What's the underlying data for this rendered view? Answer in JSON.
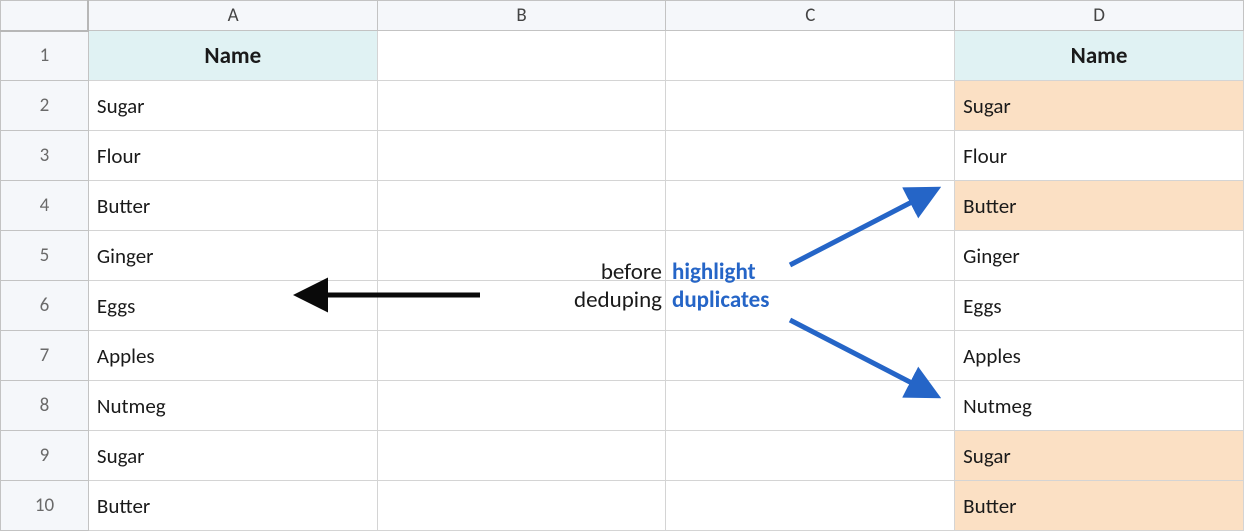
{
  "columns": [
    "A",
    "B",
    "C",
    "D"
  ],
  "row_numbers": [
    "1",
    "2",
    "3",
    "4",
    "5",
    "6",
    "7",
    "8",
    "9",
    "10"
  ],
  "headers": {
    "A": "Name",
    "D": "Name"
  },
  "data_A": [
    "Sugar",
    "Flour",
    "Butter",
    "Ginger",
    "Eggs",
    "Apples",
    "Nutmeg",
    "Sugar",
    "Butter"
  ],
  "data_D": [
    "Sugar",
    "Flour",
    "Butter",
    "Ginger",
    "Eggs",
    "Apples",
    "Nutmeg",
    "Sugar",
    "Butter"
  ],
  "highlight_D_rows": [
    2,
    4,
    9,
    10
  ],
  "annotations": {
    "before": "before",
    "deduping": "deduping",
    "highlight": "highlight",
    "duplicates": "duplicates"
  },
  "colors": {
    "header_bg": "#e0f2f3",
    "highlight_bg": "#fbe0c4",
    "arrow_black": "#0a0a0a",
    "arrow_blue": "#2565c7"
  }
}
